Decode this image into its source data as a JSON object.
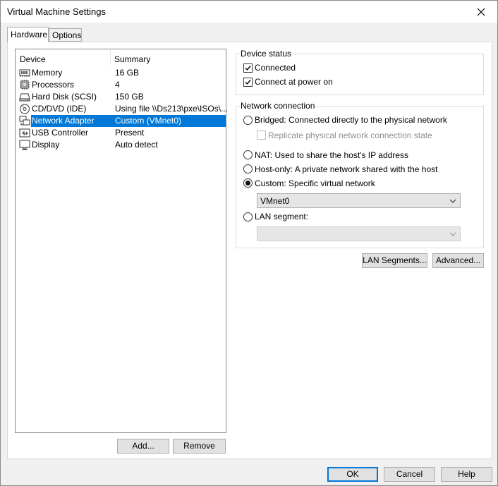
{
  "window": {
    "title": "Virtual Machine Settings"
  },
  "tabs": [
    {
      "label": "Hardware",
      "active": true
    },
    {
      "label": "Options",
      "active": false
    }
  ],
  "device_list": {
    "headers": {
      "device": "Device",
      "summary": "Summary"
    },
    "rows": [
      {
        "name": "Memory",
        "summary": "16 GB",
        "icon": "memory-icon"
      },
      {
        "name": "Processors",
        "summary": "4",
        "icon": "processor-icon"
      },
      {
        "name": "Hard Disk (SCSI)",
        "summary": "150 GB",
        "icon": "hard-disk-icon"
      },
      {
        "name": "CD/DVD (IDE)",
        "summary": "Using file \\\\Ds213\\pxe\\ISOs\\...",
        "icon": "cd-dvd-icon"
      },
      {
        "name": "Network Adapter",
        "summary": "Custom (VMnet0)",
        "icon": "network-adapter-icon",
        "selected": true
      },
      {
        "name": "USB Controller",
        "summary": "Present",
        "icon": "usb-icon"
      },
      {
        "name": "Display",
        "summary": "Auto detect",
        "icon": "display-icon"
      }
    ]
  },
  "list_buttons": {
    "add": "Add...",
    "remove": "Remove"
  },
  "device_status": {
    "title": "Device status",
    "connected": {
      "label": "Connected",
      "checked": true
    },
    "connect_at_power_on": {
      "label": "Connect at power on",
      "checked": true
    }
  },
  "network_connection": {
    "title": "Network connection",
    "bridged": "Bridged: Connected directly to the physical network",
    "replicate": "Replicate physical network connection state",
    "nat": "NAT: Used to share the host's IP address",
    "host_only": "Host-only: A private network shared with the host",
    "custom": "Custom: Specific virtual network",
    "custom_value": "VMnet0",
    "lan_segment": "LAN segment:",
    "lan_segment_value": "",
    "selected": "custom"
  },
  "panel_buttons": {
    "lan_segments": "LAN Segments...",
    "advanced": "Advanced..."
  },
  "dialog_buttons": {
    "ok": "OK",
    "cancel": "Cancel",
    "help": "Help"
  },
  "colors": {
    "selection": "#0078d7",
    "default_border": "#0078d7"
  }
}
